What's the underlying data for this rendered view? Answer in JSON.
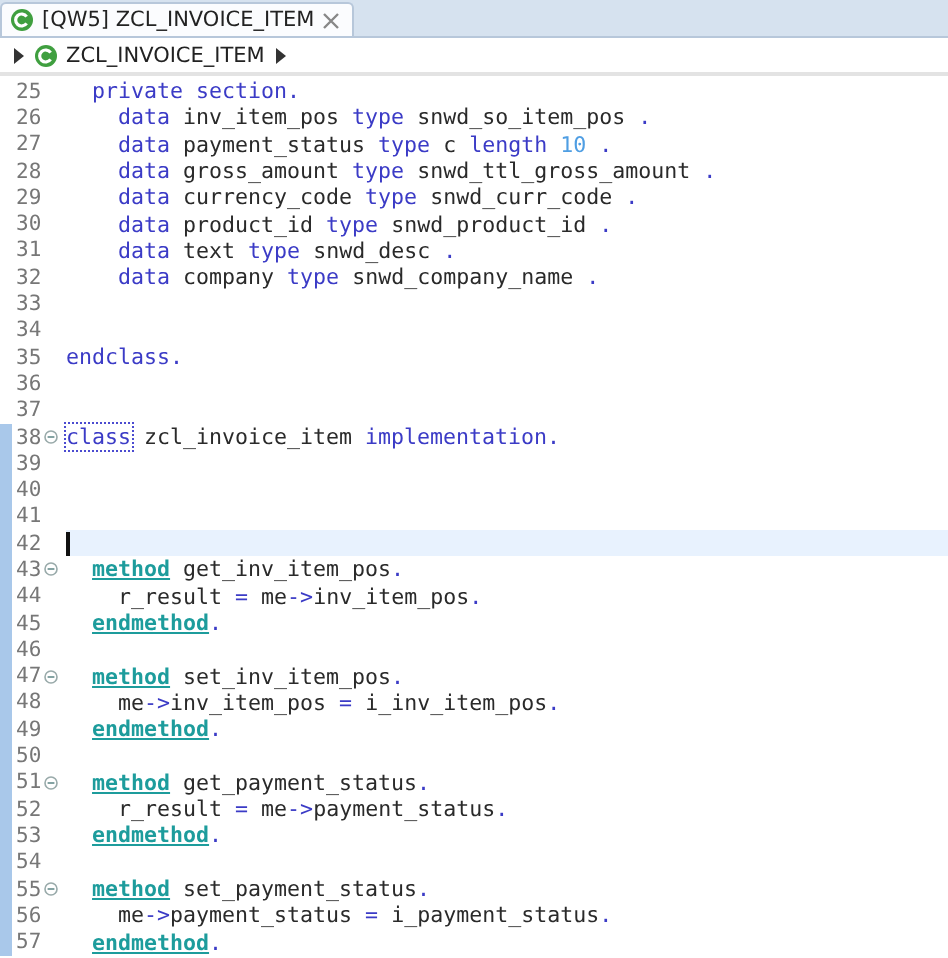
{
  "editor_tab": {
    "label": "[QW5] ZCL_INVOICE_ITEM",
    "selected": true
  },
  "breadcrumb": {
    "label": "ZCL_INVOICE_ITEM"
  },
  "lines": [
    {
      "number": "25",
      "fold": false,
      "scope": false,
      "current": false,
      "tokens": [
        {
          "kind": "kw",
          "text": "  private section."
        }
      ]
    },
    {
      "number": "26",
      "fold": false,
      "scope": false,
      "current": false,
      "tokens": [
        {
          "kind": "kw",
          "text": "    data"
        },
        {
          "kind": "id",
          "text": " inv_item_pos "
        },
        {
          "kind": "kw",
          "text": "type"
        },
        {
          "kind": "id",
          "text": " snwd_so_item_pos "
        },
        {
          "kind": "op",
          "text": "."
        }
      ]
    },
    {
      "number": "27",
      "fold": false,
      "scope": false,
      "current": false,
      "tokens": [
        {
          "kind": "kw",
          "text": "    data"
        },
        {
          "kind": "id",
          "text": " payment_status "
        },
        {
          "kind": "kw",
          "text": "type"
        },
        {
          "kind": "id",
          "text": " c "
        },
        {
          "kind": "kw",
          "text": "length"
        },
        {
          "kind": "num",
          "text": " 10 "
        },
        {
          "kind": "op",
          "text": "."
        }
      ]
    },
    {
      "number": "28",
      "fold": false,
      "scope": false,
      "current": false,
      "tokens": [
        {
          "kind": "kw",
          "text": "    data"
        },
        {
          "kind": "id",
          "text": " gross_amount "
        },
        {
          "kind": "kw",
          "text": "type"
        },
        {
          "kind": "id",
          "text": " snwd_ttl_gross_amount "
        },
        {
          "kind": "op",
          "text": "."
        }
      ]
    },
    {
      "number": "29",
      "fold": false,
      "scope": false,
      "current": false,
      "tokens": [
        {
          "kind": "kw",
          "text": "    data"
        },
        {
          "kind": "id",
          "text": " currency_code "
        },
        {
          "kind": "kw",
          "text": "type"
        },
        {
          "kind": "id",
          "text": " snwd_curr_code "
        },
        {
          "kind": "op",
          "text": "."
        }
      ]
    },
    {
      "number": "30",
      "fold": false,
      "scope": false,
      "current": false,
      "tokens": [
        {
          "kind": "kw",
          "text": "    data"
        },
        {
          "kind": "id",
          "text": " product_id "
        },
        {
          "kind": "kw",
          "text": "type"
        },
        {
          "kind": "id",
          "text": " snwd_product_id "
        },
        {
          "kind": "op",
          "text": "."
        }
      ]
    },
    {
      "number": "31",
      "fold": false,
      "scope": false,
      "current": false,
      "tokens": [
        {
          "kind": "kw",
          "text": "    data"
        },
        {
          "kind": "id",
          "text": " text "
        },
        {
          "kind": "kw",
          "text": "type"
        },
        {
          "kind": "id",
          "text": " snwd_desc "
        },
        {
          "kind": "op",
          "text": "."
        }
      ]
    },
    {
      "number": "32",
      "fold": false,
      "scope": false,
      "current": false,
      "tokens": [
        {
          "kind": "kw",
          "text": "    data"
        },
        {
          "kind": "id",
          "text": " company "
        },
        {
          "kind": "kw",
          "text": "type"
        },
        {
          "kind": "id",
          "text": " snwd_company_name "
        },
        {
          "kind": "op",
          "text": "."
        }
      ]
    },
    {
      "number": "33",
      "fold": false,
      "scope": false,
      "current": false
    },
    {
      "number": "34",
      "fold": false,
      "scope": false,
      "current": false
    },
    {
      "number": "35",
      "fold": false,
      "scope": false,
      "current": false,
      "tokens": [
        {
          "kind": "kw",
          "text": "endclass."
        }
      ]
    },
    {
      "number": "36",
      "fold": false,
      "scope": false,
      "current": false
    },
    {
      "number": "37",
      "fold": false,
      "scope": false,
      "current": false
    },
    {
      "number": "38",
      "fold": true,
      "scope": true,
      "current": false,
      "tokens": [
        {
          "kind": "kw-matched",
          "text": "class"
        },
        {
          "kind": "id",
          "text": " zcl_invoice_item "
        },
        {
          "kind": "kw",
          "text": "implementation."
        }
      ]
    },
    {
      "number": "39",
      "fold": false,
      "scope": true,
      "current": false
    },
    {
      "number": "40",
      "fold": false,
      "scope": true,
      "current": false
    },
    {
      "number": "41",
      "fold": false,
      "scope": true,
      "current": false
    },
    {
      "number": "42",
      "fold": false,
      "scope": true,
      "current": true
    },
    {
      "number": "43",
      "fold": true,
      "scope": true,
      "current": false,
      "tokens": [
        {
          "kind": "mkw",
          "text": "  method"
        },
        {
          "kind": "id",
          "text": " get_inv_item_pos"
        },
        {
          "kind": "op",
          "text": "."
        }
      ]
    },
    {
      "number": "44",
      "fold": false,
      "scope": true,
      "current": false,
      "tokens": [
        {
          "kind": "id",
          "text": "    r_result "
        },
        {
          "kind": "op",
          "text": "="
        },
        {
          "kind": "id",
          "text": " me"
        },
        {
          "kind": "op",
          "text": "->"
        },
        {
          "kind": "id",
          "text": "inv_item_pos"
        },
        {
          "kind": "op",
          "text": "."
        }
      ]
    },
    {
      "number": "45",
      "fold": false,
      "scope": true,
      "current": false,
      "tokens": [
        {
          "kind": "mkw",
          "text": "  endmethod"
        },
        {
          "kind": "op",
          "text": "."
        }
      ]
    },
    {
      "number": "46",
      "fold": false,
      "scope": true,
      "current": false
    },
    {
      "number": "47",
      "fold": true,
      "scope": true,
      "current": false,
      "tokens": [
        {
          "kind": "mkw",
          "text": "  method"
        },
        {
          "kind": "id",
          "text": " set_inv_item_pos"
        },
        {
          "kind": "op",
          "text": "."
        }
      ]
    },
    {
      "number": "48",
      "fold": false,
      "scope": true,
      "current": false,
      "tokens": [
        {
          "kind": "id",
          "text": "    me"
        },
        {
          "kind": "op",
          "text": "->"
        },
        {
          "kind": "id",
          "text": "inv_item_pos "
        },
        {
          "kind": "op",
          "text": "="
        },
        {
          "kind": "id",
          "text": " i_inv_item_pos"
        },
        {
          "kind": "op",
          "text": "."
        }
      ]
    },
    {
      "number": "49",
      "fold": false,
      "scope": true,
      "current": false,
      "tokens": [
        {
          "kind": "mkw",
          "text": "  endmethod"
        },
        {
          "kind": "op",
          "text": "."
        }
      ]
    },
    {
      "number": "50",
      "fold": false,
      "scope": true,
      "current": false
    },
    {
      "number": "51",
      "fold": true,
      "scope": true,
      "current": false,
      "tokens": [
        {
          "kind": "mkw",
          "text": "  method"
        },
        {
          "kind": "id",
          "text": " get_payment_status"
        },
        {
          "kind": "op",
          "text": "."
        }
      ]
    },
    {
      "number": "52",
      "fold": false,
      "scope": true,
      "current": false,
      "tokens": [
        {
          "kind": "id",
          "text": "    r_result "
        },
        {
          "kind": "op",
          "text": "="
        },
        {
          "kind": "id",
          "text": " me"
        },
        {
          "kind": "op",
          "text": "->"
        },
        {
          "kind": "id",
          "text": "payment_status"
        },
        {
          "kind": "op",
          "text": "."
        }
      ]
    },
    {
      "number": "53",
      "fold": false,
      "scope": true,
      "current": false,
      "tokens": [
        {
          "kind": "mkw",
          "text": "  endmethod"
        },
        {
          "kind": "op",
          "text": "."
        }
      ]
    },
    {
      "number": "54",
      "fold": false,
      "scope": true,
      "current": false
    },
    {
      "number": "55",
      "fold": true,
      "scope": true,
      "current": false,
      "tokens": [
        {
          "kind": "mkw",
          "text": "  method"
        },
        {
          "kind": "id",
          "text": " set_payment_status"
        },
        {
          "kind": "op",
          "text": "."
        }
      ]
    },
    {
      "number": "56",
      "fold": false,
      "scope": true,
      "current": false,
      "tokens": [
        {
          "kind": "id",
          "text": "    me"
        },
        {
          "kind": "op",
          "text": "->"
        },
        {
          "kind": "id",
          "text": "payment_status "
        },
        {
          "kind": "op",
          "text": "="
        },
        {
          "kind": "id",
          "text": " i_payment_status"
        },
        {
          "kind": "op",
          "text": "."
        }
      ]
    },
    {
      "number": "57",
      "fold": false,
      "scope": true,
      "current": false,
      "tokens": [
        {
          "kind": "mkw",
          "text": "  endmethod"
        },
        {
          "kind": "op",
          "text": "."
        }
      ]
    }
  ]
}
